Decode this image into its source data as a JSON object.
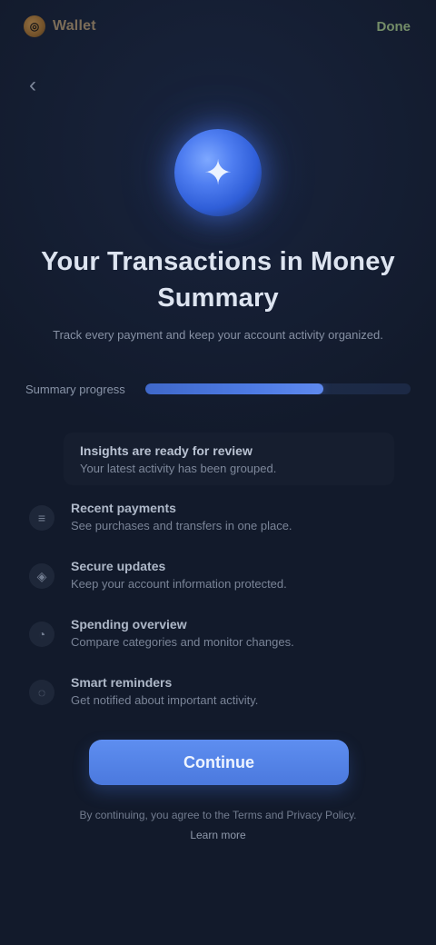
{
  "colors": {
    "background": "#121a2b",
    "accent": "#4f7ef1",
    "title": "#dde4f0",
    "muted_text": "#7e889b",
    "top_action": "#7f9a6f"
  },
  "brand": {
    "logo_icon": "wallet-icon",
    "logo_glyph": "◎",
    "name": "Wallet"
  },
  "header": {
    "top_action_label": "Done"
  },
  "navigation": {
    "back_icon": "chevron-left-icon",
    "back_glyph": "‹"
  },
  "hero": {
    "icon_name": "sparkle-icon",
    "icon_glyph": "✦"
  },
  "content": {
    "title": "Your Transactions in Money Summary",
    "subtitle": "Track every payment and keep your account activity organized.",
    "progress_label": "Summary progress",
    "progress_percent": 67
  },
  "highlight": {
    "title": "Insights are ready for review",
    "text": "Your latest activity has been grouped."
  },
  "features": [
    {
      "icon_name": "list-icon",
      "glyph": "≡",
      "title": "Recent payments",
      "text": "See purchases and transfers in one place."
    },
    {
      "icon_name": "shield-icon",
      "glyph": "◈",
      "title": "Secure updates",
      "text": "Keep your account information protected."
    },
    {
      "icon_name": "chart-icon",
      "glyph": "◔",
      "title": "Spending overview",
      "text": "Compare categories and monitor changes."
    },
    {
      "icon_name": "bell-icon",
      "glyph": "◌",
      "title": "Smart reminders",
      "text": "Get notified about important activity."
    }
  ],
  "cta": {
    "label": "Continue"
  },
  "footer": {
    "note": "By continuing, you agree to the Terms and Privacy Policy.",
    "link": "Learn more"
  }
}
